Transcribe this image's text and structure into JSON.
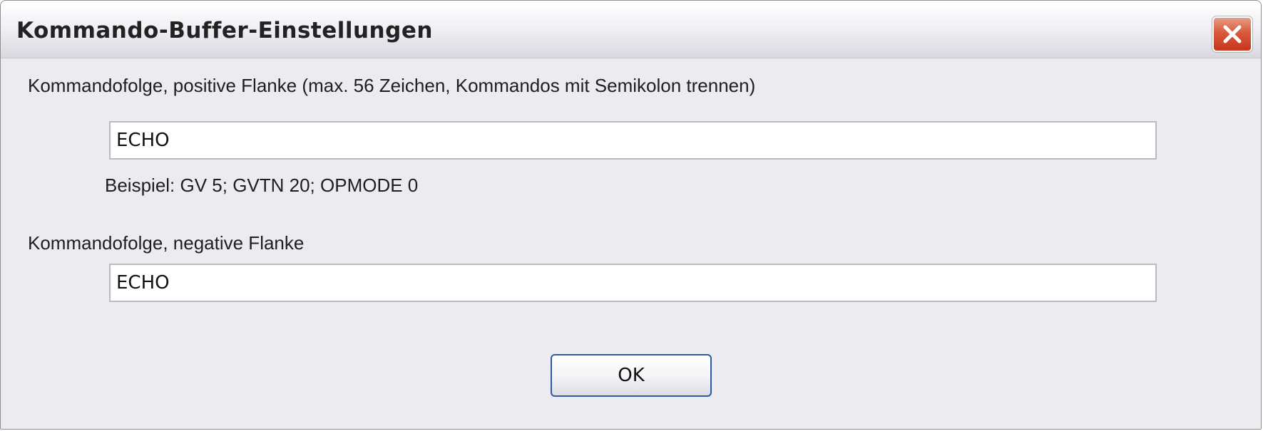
{
  "window": {
    "title": "Kommando-Buffer-Einstellungen",
    "close_icon": "close-icon"
  },
  "positive": {
    "label": "Kommandofolge, positive Flanke (max. 56  Zeichen, Kommandos mit Semikolon trennen)",
    "value": "ECHO",
    "example": "Beispiel: GV 5; GVTN 20; OPMODE 0"
  },
  "negative": {
    "label": "Kommandofolge, negative Flanke",
    "value": "ECHO"
  },
  "buttons": {
    "ok_label": "OK"
  },
  "colors": {
    "close_button": "#d4462a",
    "ok_border": "#2f5aa8",
    "dialog_background": "#ecebf0"
  }
}
